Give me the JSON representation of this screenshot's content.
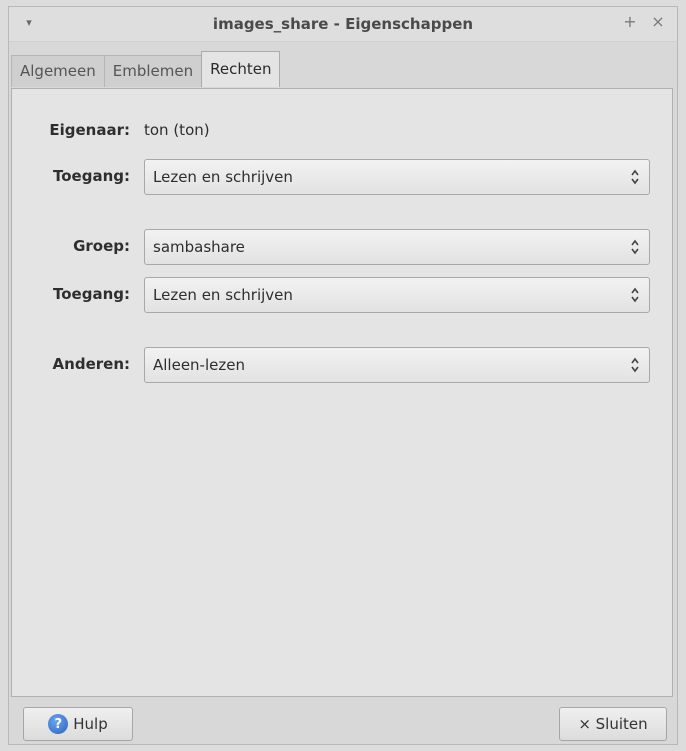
{
  "window": {
    "title": "images_share - Eigenschappen",
    "menu_glyph": "▾",
    "maximize_glyph": "+",
    "close_glyph": "×"
  },
  "tabs": [
    {
      "label": "Algemeen",
      "active": false
    },
    {
      "label": "Emblemen",
      "active": false
    },
    {
      "label": "Rechten",
      "active": true
    }
  ],
  "permissions": {
    "owner": {
      "label": "Eigenaar:",
      "value": "ton (ton)"
    },
    "owner_access": {
      "label": "Toegang:",
      "value": "Lezen en schrijven"
    },
    "group": {
      "label": "Groep:",
      "value": "sambashare"
    },
    "group_access": {
      "label": "Toegang:",
      "value": "Lezen en schrijven"
    },
    "others": {
      "label": "Anderen:",
      "value": "Alleen-lezen"
    }
  },
  "footer": {
    "help_label": "Hulp",
    "help_icon": "?",
    "close_label": "× Sluiten"
  },
  "colors": {
    "help_icon": "#2a62c0"
  }
}
